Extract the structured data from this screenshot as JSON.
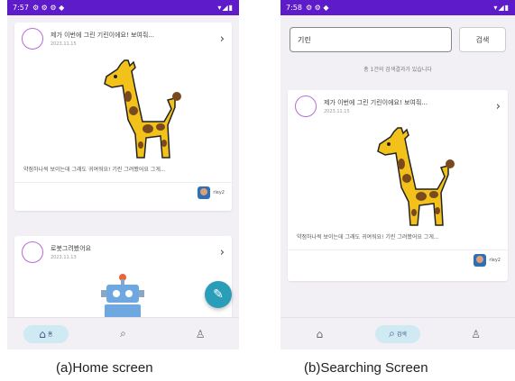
{
  "colors": {
    "statusbar": "#5d1bc9",
    "fab": "#2a9db8",
    "nav_active_bg": "#cfeaf3",
    "avatar_ring": "#b86bd8"
  },
  "home": {
    "status_time": "7:57",
    "status_icons": "⚙ ⚙ ⚙ ◆",
    "status_right": "▾◢▮",
    "post1": {
      "title": "제가 이번에 그린 기린이에요! 보여줘...",
      "date": "2023.11.15",
      "caption": "약점하나씩 보이는데 그래도 귀여워요! 기린 그려봤어요 그게...",
      "user": "rley2"
    },
    "post2": {
      "title": "로봇그려봤어요",
      "date": "2023.11.13"
    },
    "fab_icon": "pencil-icon",
    "nav": {
      "home_label": "홈"
    }
  },
  "search": {
    "status_time": "7:58",
    "status_icons": "⚙ ⚙ ◆",
    "status_right": "▾◢▮",
    "input_value": "기린",
    "button_label": "검색",
    "result_note": "총 1건의 검색결과가 있습니다",
    "post1": {
      "title": "제가 이번에 그린 기린이에요! 보여줘...",
      "date": "2023.11.15",
      "caption": "약점하나씩 보이는데 그래도 귀여워요! 기린 그려봤어요 그게...",
      "user": "rley2"
    },
    "nav": {
      "search_label": "검색"
    }
  },
  "captions": {
    "a": "(a)Home screen",
    "b": "(b)Searching Screen"
  }
}
